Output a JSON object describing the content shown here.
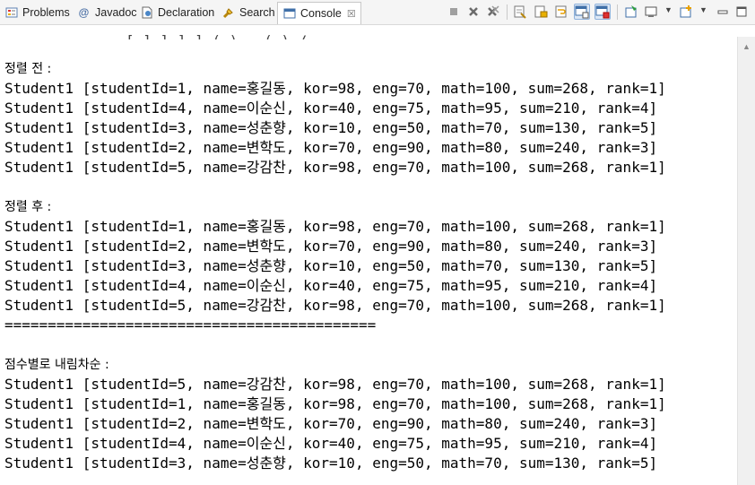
{
  "tabs": [
    {
      "label": "Problems",
      "icon": "problems-icon"
    },
    {
      "label": "Javadoc",
      "icon": "javadoc-at-icon"
    },
    {
      "label": "Declaration",
      "icon": "declaration-icon"
    },
    {
      "label": "Search",
      "icon": "search-flashlight-icon"
    },
    {
      "label": "Console",
      "icon": "console-icon",
      "close": "☒"
    }
  ],
  "colors": {
    "terminate_red": "#c74b3b",
    "toolbar_bg": "#f5f5f5",
    "active_tab": "#ffffff",
    "pressed_blue": "#dde8f6"
  },
  "console": {
    "cut_line": "[ ] ] ] ] ( ) , ( ) /",
    "lines": [
      "정렬 전 :",
      "Student1 [studentId=1, name=홍길동, kor=98, eng=70, math=100, sum=268, rank=1]",
      "Student1 [studentId=4, name=이순신, kor=40, eng=75, math=95, sum=210, rank=4]",
      "Student1 [studentId=3, name=성춘향, kor=10, eng=50, math=70, sum=130, rank=5]",
      "Student1 [studentId=2, name=변학도, kor=70, eng=90, math=80, sum=240, rank=3]",
      "Student1 [studentId=5, name=강감찬, kor=98, eng=70, math=100, sum=268, rank=1]",
      "",
      "정렬 후 :",
      "Student1 [studentId=1, name=홍길동, kor=98, eng=70, math=100, sum=268, rank=1]",
      "Student1 [studentId=2, name=변학도, kor=70, eng=90, math=80, sum=240, rank=3]",
      "Student1 [studentId=3, name=성춘향, kor=10, eng=50, math=70, sum=130, rank=5]",
      "Student1 [studentId=4, name=이순신, kor=40, eng=75, math=95, sum=210, rank=4]",
      "Student1 [studentId=5, name=강감찬, kor=98, eng=70, math=100, sum=268, rank=1]",
      "===========================================",
      "",
      "점수별로 내림차순 :",
      "Student1 [studentId=5, name=강감찬, kor=98, eng=70, math=100, sum=268, rank=1]",
      "Student1 [studentId=1, name=홍길동, kor=98, eng=70, math=100, sum=268, rank=1]",
      "Student1 [studentId=2, name=변학도, kor=70, eng=90, math=80, sum=240, rank=3]",
      "Student1 [studentId=4, name=이순신, kor=40, eng=75, math=95, sum=210, rank=4]",
      "Student1 [studentId=3, name=성춘향, kor=10, eng=50, math=70, sum=130, rank=5]"
    ]
  }
}
